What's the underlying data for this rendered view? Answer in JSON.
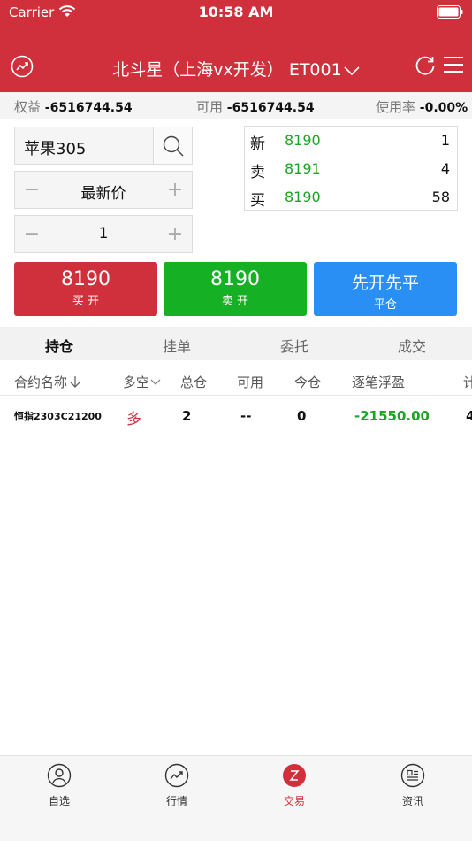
{
  "status_bar": {
    "carrier": "Carrier",
    "time": "10:58 AM"
  },
  "nav": {
    "title": "北斗星（上海vx开发） ET001"
  },
  "account": {
    "equity_label": "权益",
    "equity_value": "-6516744.54",
    "available_label": "可用",
    "available_value": "-6516744.54",
    "usage_label": "使用率",
    "usage_value": "-0.00%"
  },
  "order": {
    "symbol": "苹果305",
    "price_mode": "最新价",
    "quantity": "1",
    "minus_label": "−",
    "plus_label": "+"
  },
  "quote": [
    {
      "label": "新",
      "price": "8190",
      "volume": "1"
    },
    {
      "label": "卖",
      "price": "8191",
      "volume": "4"
    },
    {
      "label": "买",
      "price": "8190",
      "volume": "58"
    }
  ],
  "actions": {
    "buy_price": "8190",
    "buy_label": "买 开",
    "sell_price": "8190",
    "sell_label": "卖 开",
    "close_title": "先开先平",
    "close_label": "平仓"
  },
  "tabs": [
    "持仓",
    "挂单",
    "委托",
    "成交"
  ],
  "table": {
    "headers": [
      "合约名称",
      "多空",
      "总仓",
      "可用",
      "今仓",
      "逐笔浮盈",
      "计"
    ],
    "rows": [
      {
        "contract": "恒指2303C21200",
        "side": "多",
        "total": "2",
        "available": "--",
        "today": "0",
        "pnl": "-21550.00",
        "extra": "4"
      }
    ]
  },
  "bottom_nav": [
    {
      "label": "自选",
      "icon": "user-icon"
    },
    {
      "label": "行情",
      "icon": "trend-icon"
    },
    {
      "label": "交易",
      "icon": "trade-icon"
    },
    {
      "label": "资讯",
      "icon": "news-icon"
    }
  ],
  "colors": {
    "brand": "#d0303c",
    "buy": "#d0303c",
    "sell": "#16b024",
    "close": "#2a8ff5",
    "price_green": "#1aa526"
  }
}
